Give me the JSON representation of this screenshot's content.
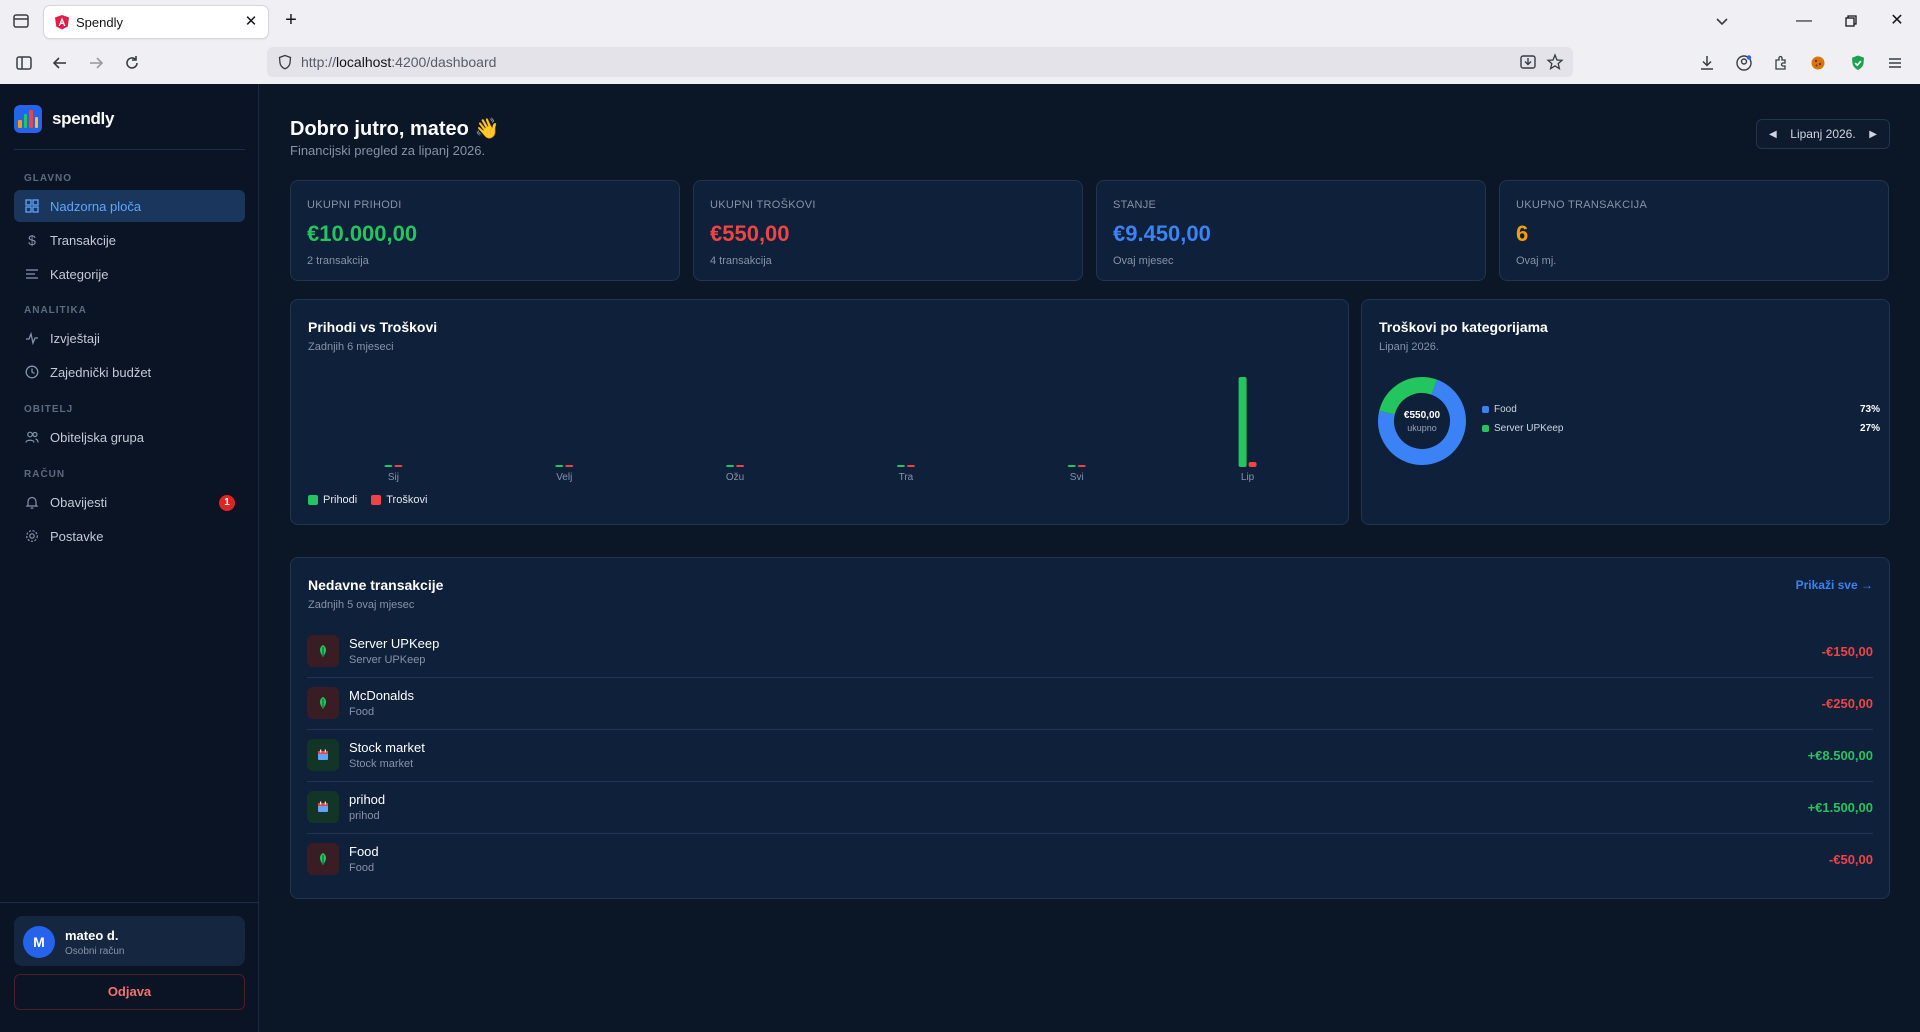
{
  "browser": {
    "tab_title": "Spendly",
    "url_prefix": "http://",
    "url_host": "localhost",
    "url_path": ":4200/dashboard"
  },
  "brand": {
    "name": "spendly"
  },
  "sidebar": {
    "sections": [
      {
        "label": "GLAVNO"
      },
      {
        "label": "ANALITIKA"
      },
      {
        "label": "OBITELJ"
      },
      {
        "label": "RAČUN"
      }
    ],
    "items": [
      {
        "label": "Nadzorna ploča",
        "icon": "grid-icon",
        "active": true
      },
      {
        "label": "Transakcije",
        "icon": "dollar-icon"
      },
      {
        "label": "Kategorije",
        "icon": "list-icon"
      },
      {
        "label": "Izvještaji",
        "icon": "activity-icon"
      },
      {
        "label": "Zajednički budžet",
        "icon": "clock-icon"
      },
      {
        "label": "Obiteljska grupa",
        "icon": "users-icon"
      },
      {
        "label": "Obavijesti",
        "icon": "bell-icon",
        "badge": "1"
      },
      {
        "label": "Postavke",
        "icon": "gear-icon"
      }
    ],
    "user": {
      "initial": "M",
      "name": "mateo d.",
      "subtitle": "Osobni račun"
    },
    "logout_label": "Odjava"
  },
  "header": {
    "greeting": "Dobro jutro, mateo",
    "wave": "👋",
    "subtitle": "Financijski pregled za lipanj 2026.",
    "month_selector": "Lipanj 2026."
  },
  "stats": [
    {
      "label": "UKUPNI PRIHODI",
      "value": "€10.000,00",
      "sub": "2 transakcija",
      "color": "#22c55e"
    },
    {
      "label": "UKUPNI TROŠKOVI",
      "value": "€550,00",
      "sub": "4 transakcija",
      "color": "#ef4444"
    },
    {
      "label": "STANJE",
      "value": "€9.450,00",
      "sub": "Ovaj mjesec",
      "color": "#3b82f6"
    },
    {
      "label": "UKUPNO TRANSAKCIJA",
      "value": "6",
      "sub": "Ovaj mj.",
      "color": "#f59e0b"
    }
  ],
  "income_chart": {
    "title": "Prihodi vs Troškovi",
    "subtitle": "Zadnjih 6 mjeseci"
  },
  "category_chart": {
    "title": "Troškovi po kategorijama",
    "subtitle": "Lipanj 2026.",
    "center_value": "€550,00",
    "center_label": "ukupno"
  },
  "chart_data": [
    {
      "type": "bar",
      "categories": [
        "Sij",
        "Velj",
        "Ožu",
        "Tra",
        "Svi",
        "Lip"
      ],
      "series": [
        {
          "name": "Prihodi",
          "color": "#22c55e",
          "values": [
            0,
            0,
            0,
            0,
            0,
            10000
          ]
        },
        {
          "name": "Troškovi",
          "color": "#ef4444",
          "values": [
            0,
            0,
            0,
            0,
            0,
            550
          ]
        }
      ],
      "ylim": [
        0,
        10000
      ],
      "grid": false,
      "legend": "bottom-left"
    },
    {
      "type": "pie",
      "donut": true,
      "categories": [
        "Food",
        "Server UPKeep"
      ],
      "values": [
        73,
        27
      ],
      "labels": [
        "73%",
        "27%"
      ],
      "colors": [
        "#3b82f6",
        "#22c55e"
      ],
      "legend": "right"
    }
  ],
  "recent": {
    "title": "Nedavne transakcije",
    "subtitle": "Zadnjih 5 ovaj mjesec",
    "view_all": "Prikaži sve →",
    "items": [
      {
        "name": "Server UPKeep",
        "category": "Server UPKeep",
        "amount": "-€150,00",
        "type": "expense",
        "icon": "leaf-icon"
      },
      {
        "name": "McDonalds",
        "category": "Food",
        "amount": "-€250,00",
        "type": "expense",
        "icon": "leaf-icon"
      },
      {
        "name": "Stock market",
        "category": "Stock market",
        "amount": "+€8.500,00",
        "type": "income",
        "icon": "calendar-icon"
      },
      {
        "name": "prihod",
        "category": "prihod",
        "amount": "+€1.500,00",
        "type": "income",
        "icon": "calendar-icon"
      },
      {
        "name": "Food",
        "category": "Food",
        "amount": "-€50,00",
        "type": "expense",
        "icon": "leaf-icon"
      }
    ]
  }
}
